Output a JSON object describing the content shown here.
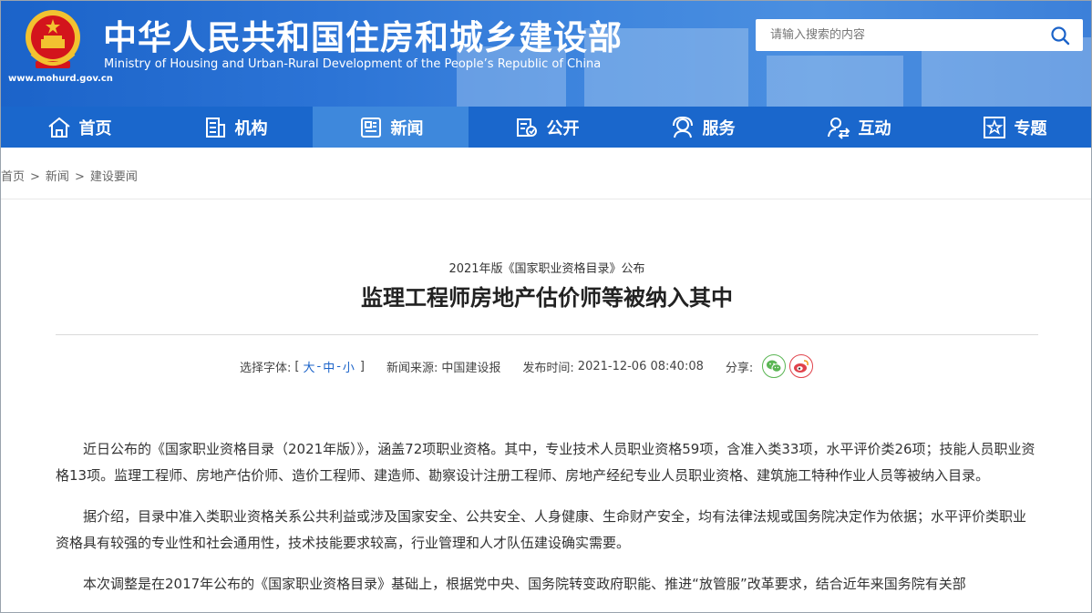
{
  "header": {
    "title_cn": "中华人民共和国住房和城乡建设部",
    "title_en": "Ministry of Housing and Urban-Rural Development of the People’s Republic of China",
    "site_url": "www.mohurd.gov.cn",
    "emblem_icon": "national-emblem-icon",
    "search_placeholder": "请输入搜索的内容",
    "search_icon": "search-icon",
    "brand_color": "#1b63c9"
  },
  "nav": {
    "items": [
      {
        "label": "首页",
        "icon": "home-icon"
      },
      {
        "label": "机构",
        "icon": "building-icon"
      },
      {
        "label": "新闻",
        "icon": "news-icon"
      },
      {
        "label": "公开",
        "icon": "disclosure-icon"
      },
      {
        "label": "服务",
        "icon": "service-icon"
      },
      {
        "label": "互动",
        "icon": "interaction-icon"
      },
      {
        "label": "专题",
        "icon": "star-topic-icon"
      }
    ],
    "active": "新闻"
  },
  "breadcrumb": {
    "items": [
      "首页",
      "新闻",
      "建设要闻"
    ],
    "separator": ">"
  },
  "article": {
    "subtitle": "2021年版《国家职业资格目录》公布",
    "title": "监理工程师房地产估价师等被纳入其中",
    "meta": {
      "font_label": "选择字体:",
      "bracket_open": "[",
      "bracket_close": "]",
      "font_large": "大",
      "font_medium": "中",
      "font_small": "小",
      "dash": "-",
      "source_label": "新闻来源:",
      "source": "中国建设报",
      "time_label": "发布时间:",
      "time": "2021-12-06 08:40:08",
      "share_label": "分享:"
    },
    "paragraphs": [
      "近日公布的《国家职业资格目录（2021年版）》，涵盖72项职业资格。其中，专业技术人员职业资格59项，含准入类33项，水平评价类26项；技能人员职业资格13项。监理工程师、房地产估价师、造价工程师、建造师、勘察设计注册工程师、房地产经纪专业人员职业资格、建筑施工特种作业人员等被纳入目录。",
      "据介绍，目录中准入类职业资格关系公共利益或涉及国家安全、公共安全、人身健康、生命财产安全，均有法律法规或国务院决定作为依据；水平评价类职业资格具有较强的专业性和社会通用性，技术技能要求较高，行业管理和人才队伍建设确实需要。",
      "本次调整是在2017年公布的《国家职业资格目录》基础上，根据党中央、国务院转变政府职能、推进“放管服”改革要求，结合近年来国务院有关部"
    ]
  }
}
